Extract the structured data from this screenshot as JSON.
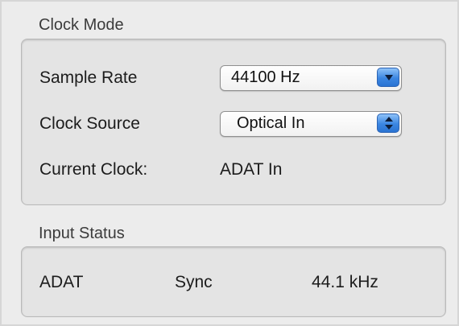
{
  "clock_mode": {
    "title": "Clock Mode",
    "sample_rate": {
      "label": "Sample Rate",
      "value": "44100 Hz",
      "icon": "popup-arrow-down-icon"
    },
    "clock_source": {
      "label": "Clock Source",
      "value": "Optical In",
      "icon": "stepper-updown-icon"
    },
    "current_clock": {
      "label": "Current Clock:",
      "value": "ADAT In"
    }
  },
  "input_status": {
    "title": "Input Status",
    "row": {
      "input": "ADAT",
      "state": "Sync",
      "rate": "44.1 kHz"
    }
  },
  "colors": {
    "accent": "#3b86e2",
    "panel_bg": "#e4e4e4",
    "window_bg": "#ececec"
  }
}
